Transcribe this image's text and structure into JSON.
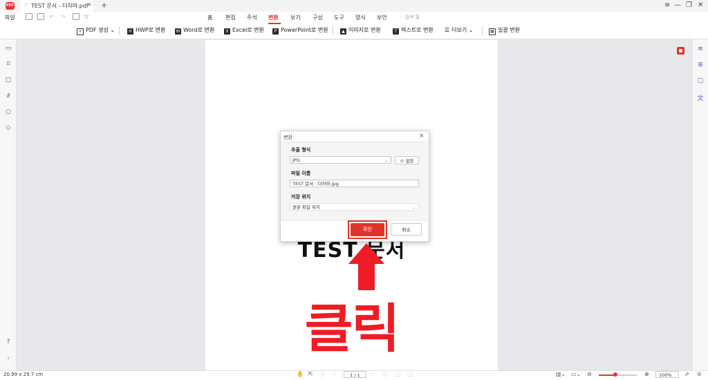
{
  "app": {
    "logo_text": "PDF"
  },
  "tab": {
    "title": "TEST 문서 - 더차마.pdf",
    "close": "×",
    "new_tab": "+"
  },
  "window_controls": {
    "menu": "≡",
    "minimize": "—",
    "restore": "❐",
    "close": "✕"
  },
  "menu": {
    "file": "파일",
    "items": [
      "홈",
      "편집",
      "주석",
      "변환",
      "보기",
      "구성",
      "도구",
      "양식",
      "보안"
    ],
    "active": "변환",
    "assistant": "검색 툴"
  },
  "toolbar": {
    "pdf_create": "PDF 생성",
    "hwp": "HWP로 변환",
    "word": "Word로 변환",
    "excel": "Excel로 변환",
    "ppt": "PowerPoint로 변환",
    "image": "이미지로 변환",
    "text": "텍스트로 변환",
    "more": "더보기",
    "batch": "일괄 변환"
  },
  "document": {
    "heading": "TEST 문서",
    "overlay_text": "클릭"
  },
  "dialog": {
    "title": "변환",
    "close": "×",
    "format_label": "추출 형식",
    "format_value": "JPG",
    "settings_label": "설정",
    "filename_label": "파일 이름",
    "filename_value": "TEST 문서 - 더차마.jpg",
    "location_label": "저장 위치",
    "location_value": "원본 파일 위치",
    "ok_label": "확인",
    "cancel_label": "취소"
  },
  "statusbar": {
    "page_size": "20.99 x 29.7 cm",
    "page_indicator": "1 / 1",
    "zoom": "100%"
  },
  "colors": {
    "accent": "#e0332c",
    "annotation_red": "#ee1c25",
    "ai_purple": "#7a3fbf"
  }
}
